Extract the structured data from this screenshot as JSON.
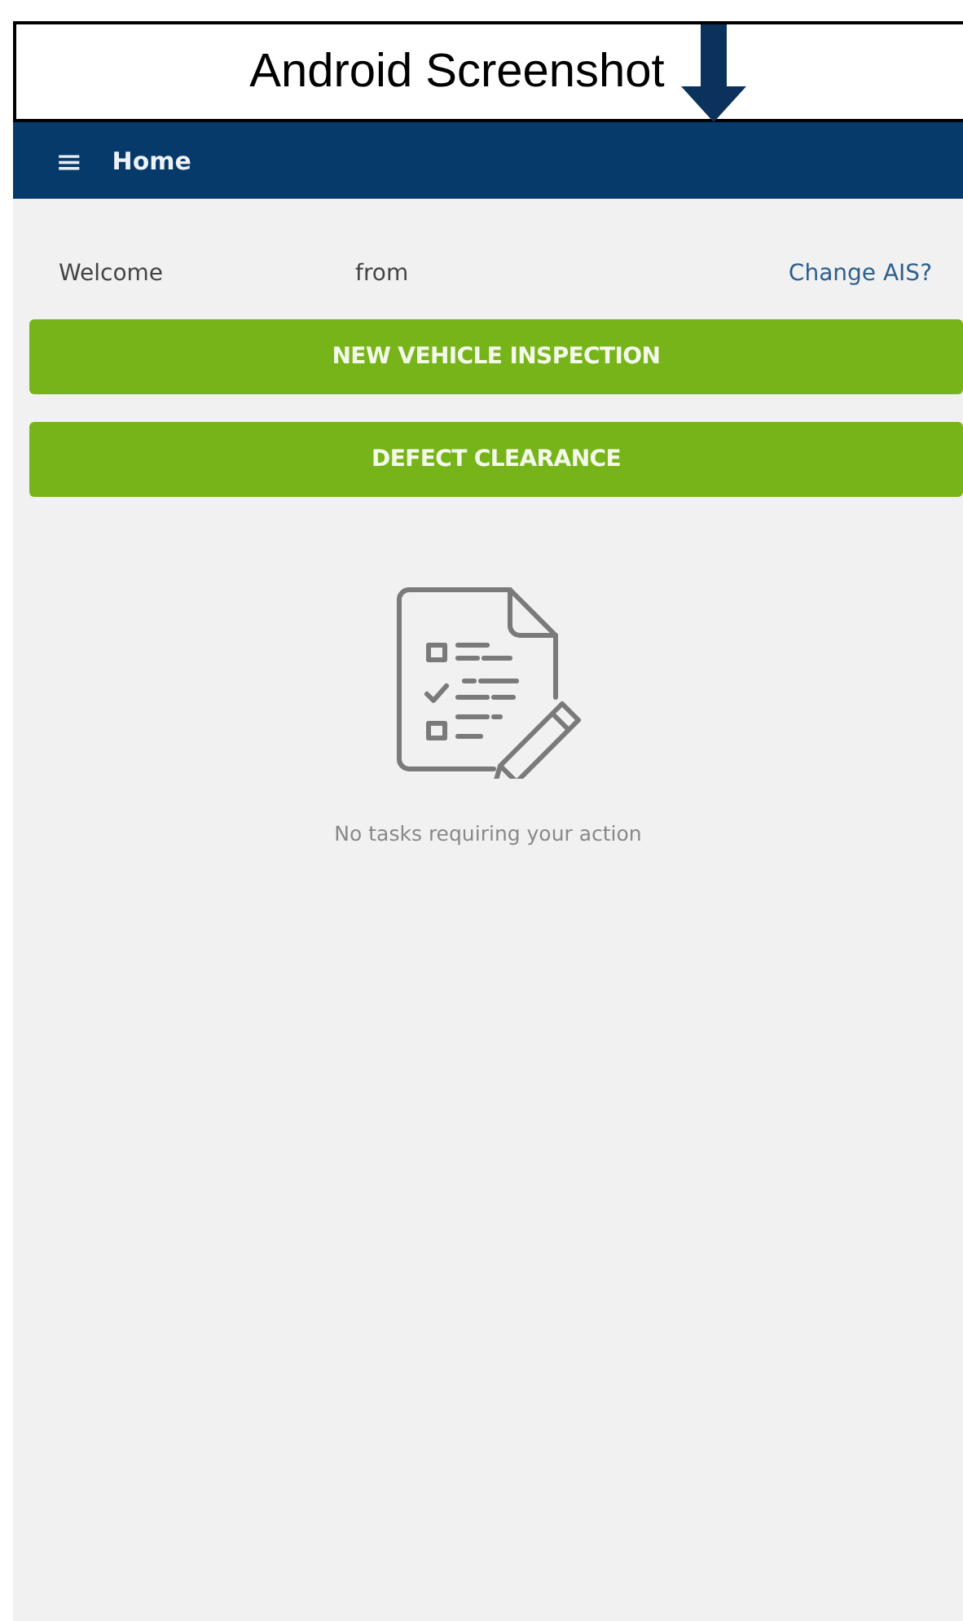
{
  "caption": {
    "title": "Android Screenshot"
  },
  "app_bar": {
    "menu_icon": "≡",
    "title": "Home"
  },
  "welcome": {
    "greeting": "Welcome",
    "from": "from",
    "link": "Change AIS?"
  },
  "buttons": [
    "NEW VEHICLE INSPECTION",
    "DEFECT CLEARANCE"
  ],
  "empty_state": {
    "message": "No tasks requiring your action"
  }
}
